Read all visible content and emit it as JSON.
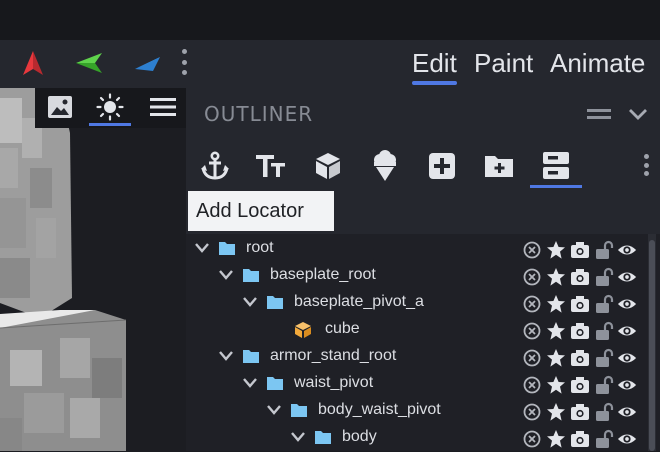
{
  "toolbar": {
    "tools": [
      {
        "name": "red-arrow-tool-icon",
        "color": "#e8383d"
      },
      {
        "name": "green-arrow-tool-icon",
        "color": "#44c233"
      },
      {
        "name": "blue-arrow-tool-icon",
        "color": "#3f94e6"
      }
    ],
    "modes": [
      {
        "label": "Edit",
        "active": true
      },
      {
        "label": "Paint",
        "active": false
      },
      {
        "label": "Animate",
        "active": false
      }
    ]
  },
  "viewport": {
    "buttons": [
      "image-icon",
      "light-icon",
      "menu-icon"
    ],
    "active_button": "light-icon"
  },
  "outliner": {
    "title": "OUTLINER",
    "tools": [
      "add-locator-icon",
      "text-icon",
      "cube-icon",
      "ice-cream-icon",
      "add-cube-icon",
      "add-folder-icon",
      "outliner-toggle-icon"
    ],
    "active_tool": "outliner-toggle-icon",
    "tooltip": "Add Locator",
    "rows": [
      {
        "label": "root",
        "type": "group",
        "depth": 0,
        "expanded": true
      },
      {
        "label": "baseplate_root",
        "type": "group",
        "depth": 1,
        "expanded": true
      },
      {
        "label": "baseplate_pivot_a",
        "type": "group",
        "depth": 2,
        "expanded": true
      },
      {
        "label": "cube",
        "type": "cube",
        "depth": 3,
        "expanded": false
      },
      {
        "label": "armor_stand_root",
        "type": "group",
        "depth": 1,
        "expanded": true
      },
      {
        "label": "waist_pivot",
        "type": "group",
        "depth": 2,
        "expanded": true
      },
      {
        "label": "body_waist_pivot",
        "type": "group",
        "depth": 3,
        "expanded": true
      },
      {
        "label": "body",
        "type": "group",
        "depth": 4,
        "expanded": true
      }
    ],
    "row_actions": [
      "remove-icon",
      "star-icon",
      "camera-icon",
      "lock-icon",
      "visibility-icon"
    ]
  },
  "colors": {
    "accent": "#4f78e3",
    "folder": "#7cc6f2",
    "cube": "#f2a93b"
  }
}
